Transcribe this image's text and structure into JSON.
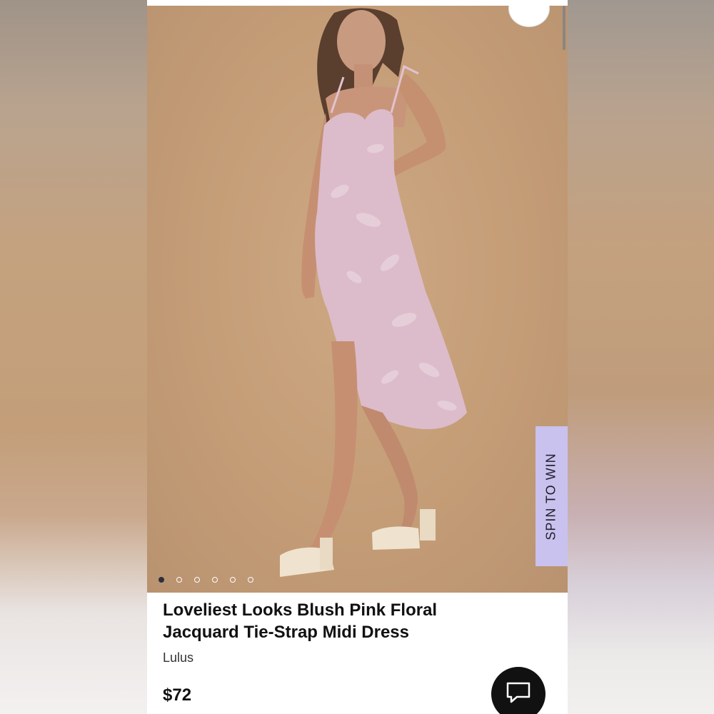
{
  "product": {
    "title": "Loveliest Looks Blush Pink Floral Jacquard Tie-Strap Midi Dress",
    "brand": "Lulus",
    "price": "$72"
  },
  "gallery": {
    "image_count": 6,
    "active_index": 0
  },
  "promo": {
    "spin_label": "SPIN TO WIN",
    "color": "#c9c2ee"
  },
  "icons": {
    "next": "chevron-right-icon",
    "chat": "chat-bubble-icon"
  },
  "colors": {
    "photo_background": "#c49d77",
    "dress": "#dcbccb",
    "chat_button": "#111111"
  }
}
